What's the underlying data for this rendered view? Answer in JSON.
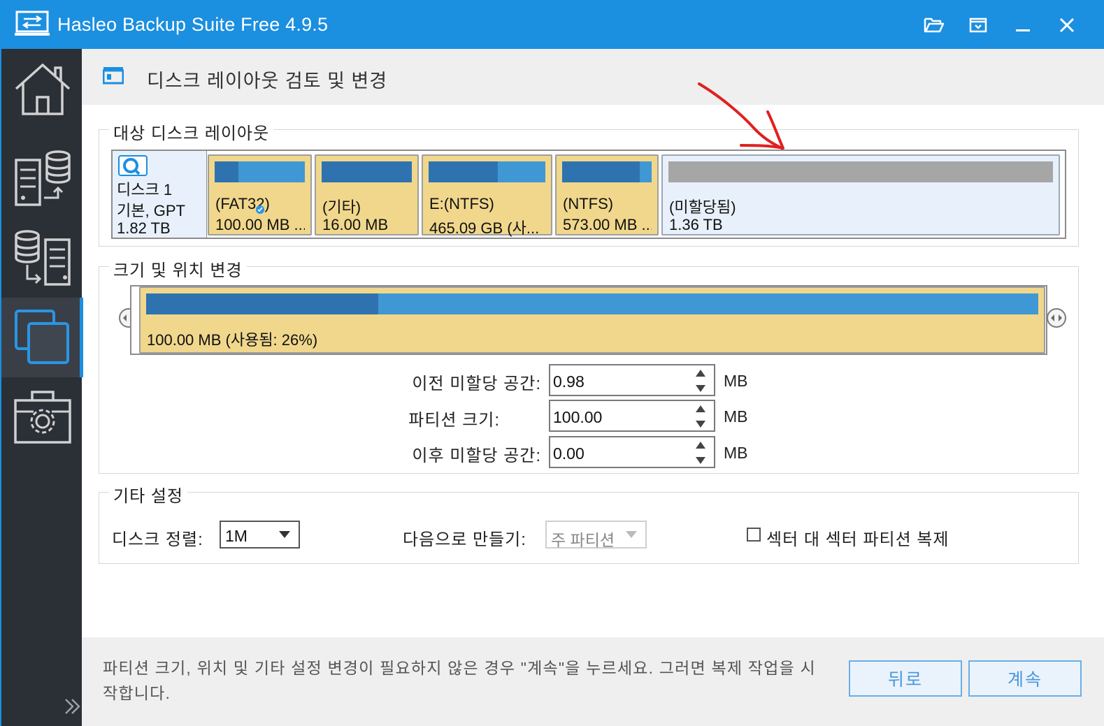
{
  "window": {
    "title": "Hasleo Backup Suite Free 4.9.5"
  },
  "header": {
    "title": "디스크 레이아웃 검토 및 변경"
  },
  "target_layout": {
    "group_title": "대상 디스크 레이아웃",
    "disk": {
      "name": "디스크 1",
      "type": "기본, GPT",
      "size": "1.82 TB"
    },
    "partitions": [
      {
        "name": "(FAT32)",
        "size": "100.00 MB ...",
        "used_fraction": 0.26,
        "selected": true
      },
      {
        "name": "(기타)",
        "size": "16.00 MB",
        "used_fraction": 1.0,
        "selected": false
      },
      {
        "name": "E:(NTFS)",
        "size": "465.09 GB (사...",
        "used_fraction": 0.59,
        "selected": false
      },
      {
        "name": "(NTFS)",
        "size": "573.00 MB ...",
        "used_fraction": 0.87,
        "selected": false
      },
      {
        "name": "(미할당됨)",
        "size": "1.36 TB",
        "used_fraction": 0.0,
        "selected": false
      }
    ]
  },
  "resize": {
    "group_title": "크기 및 위치 변경",
    "partition_label": "100.00 MB (사용됨: 26%)",
    "used_fraction": 0.26,
    "fields": [
      {
        "label": "이전 미할당 공간:",
        "value": "0.98",
        "unit": "MB"
      },
      {
        "label": "파티션 크기:",
        "value": "100.00",
        "unit": "MB"
      },
      {
        "label": "이후 미할당 공간:",
        "value": "0.00",
        "unit": "MB"
      }
    ]
  },
  "other": {
    "group_title": "기타 설정",
    "align_label": "디스크 정렬:",
    "align_value": "1M",
    "create_as_label": "다음으로 만들기:",
    "create_as_value": "주 파티션",
    "sector_copy_label": "섹터 대 섹터 파티션 복제",
    "sector_copy_checked": false
  },
  "footer": {
    "message": "파티션 크기, 위치 및 기타 설정 변경이 필요하지 않은 경우 \"계속\"을 누르세요. 그러면 복제 작업을 시작합니다.",
    "back_label": "뒤로",
    "next_label": "계속"
  },
  "colors": {
    "titlebar": "#1b8fe0",
    "sidebar": "#2b2f36",
    "partition_fill": "#f0d78c",
    "used_bar": "#2e73b0",
    "free_bar": "#3f97d4",
    "unallocated_bar": "#a6a6a6",
    "annotation_arrow": "#e02020"
  }
}
